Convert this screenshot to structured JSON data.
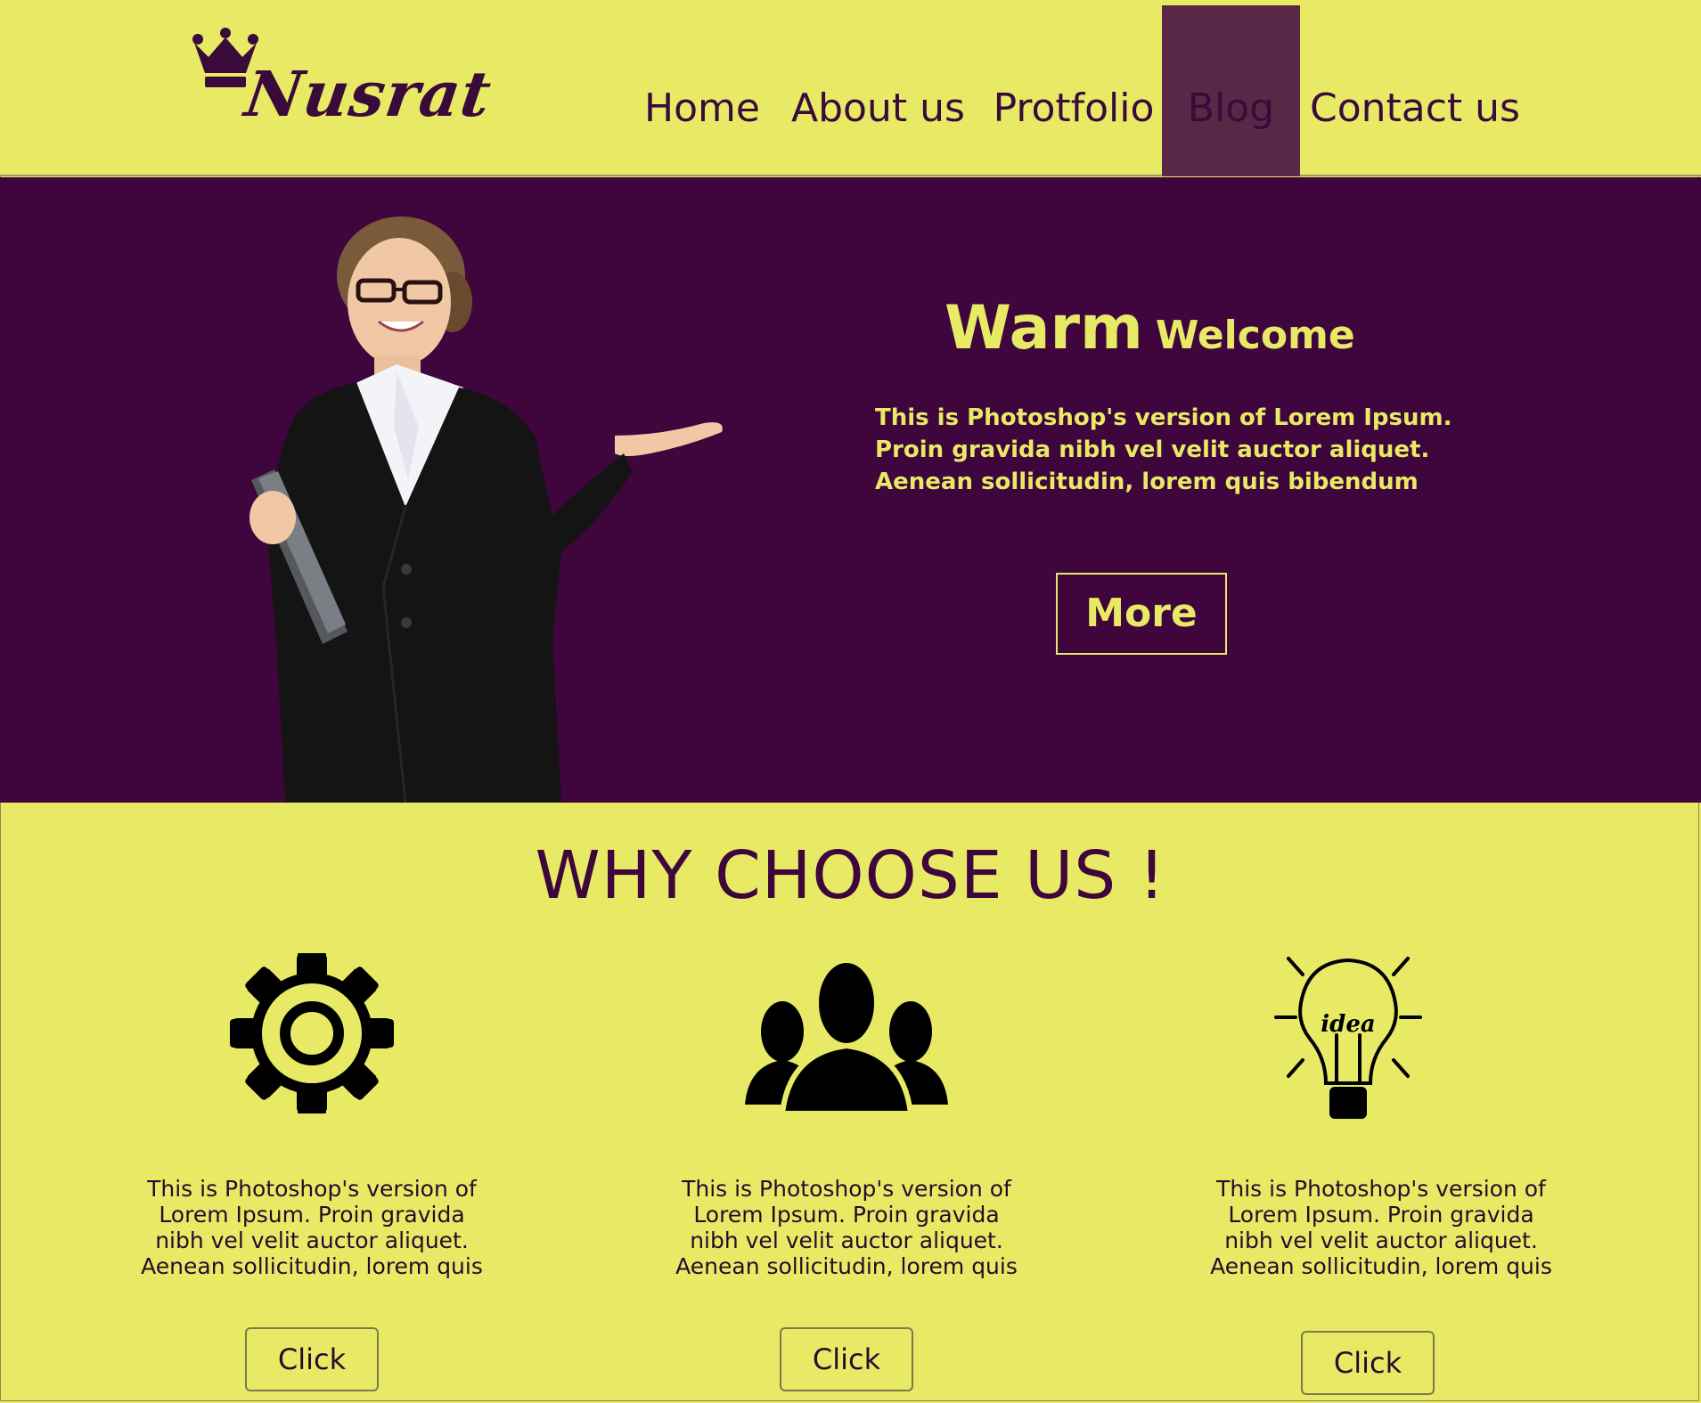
{
  "brand": {
    "name": "Nusrat"
  },
  "nav": {
    "items": [
      {
        "label": "Home"
      },
      {
        "label": "About us"
      },
      {
        "label": "Protfolio"
      },
      {
        "label": "Blog"
      },
      {
        "label": "Contact us"
      }
    ],
    "active_index": 3
  },
  "hero": {
    "title_big": "Warm",
    "title_small": "Welcome",
    "lines": [
      "This is Photoshop's version  of Lorem Ipsum.",
      "Proin gravida nibh vel velit auctor aliquet.",
      "Aenean sollicitudin, lorem quis bibendum"
    ],
    "button_label": "More"
  },
  "why": {
    "title": "WHY CHOOSE US !",
    "features": [
      {
        "icon": "gear-icon",
        "lines": [
          "This is Photoshop's version  of",
          "Lorem Ipsum. Proin gravida",
          "nibh vel velit auctor aliquet.",
          "Aenean sollicitudin, lorem quis"
        ],
        "button_label": "Click"
      },
      {
        "icon": "team-icon",
        "lines": [
          "This is Photoshop's version  of",
          "Lorem Ipsum. Proin gravida",
          "nibh vel velit auctor aliquet.",
          "Aenean sollicitudin, lorem quis"
        ],
        "button_label": "Click"
      },
      {
        "icon": "idea-bulb-icon",
        "icon_text": "idea",
        "lines": [
          "This is Photoshop's version  of",
          "Lorem Ipsum. Proin gravida",
          "nibh vel velit auctor aliquet.",
          "Aenean sollicitudin, lorem quis"
        ],
        "button_label": "Click"
      }
    ]
  },
  "colors": {
    "background": "#e8ea66",
    "hero_background": "#3e063c",
    "active_nav": "#5a2847",
    "brand": "#3a0a3a"
  }
}
